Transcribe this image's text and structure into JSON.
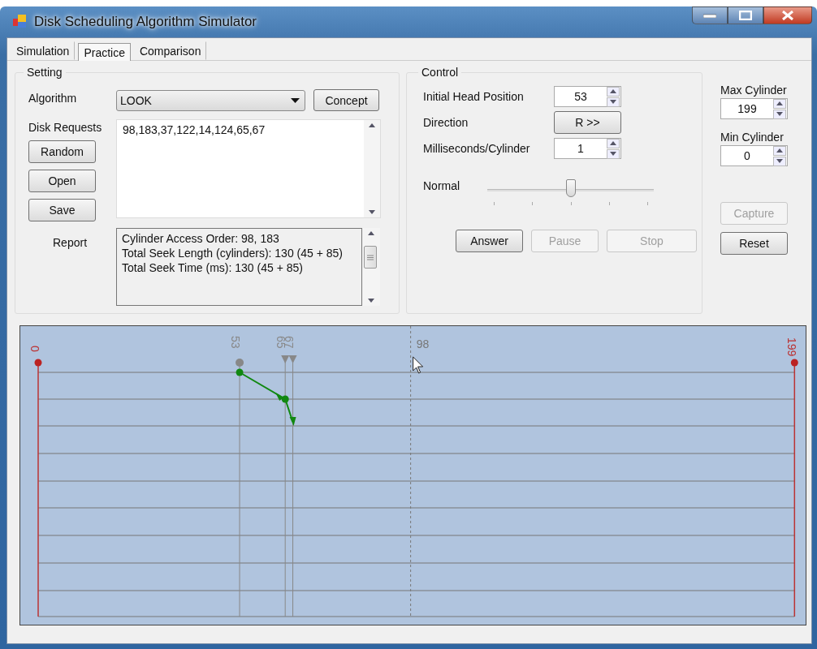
{
  "window": {
    "title": "Disk Scheduling Algorithm Simulator"
  },
  "tabs": [
    {
      "label": "Simulation",
      "selected": false
    },
    {
      "label": "Practice",
      "selected": true
    },
    {
      "label": "Comparison",
      "selected": false
    }
  ],
  "setting": {
    "title": "Setting",
    "algorithm": {
      "label": "Algorithm",
      "value": "LOOK"
    },
    "concept_button": "Concept",
    "disk_requests": {
      "label": "Disk Requests",
      "value": "98,183,37,122,14,124,65,67"
    },
    "buttons": [
      "Random",
      "Open",
      "Save"
    ],
    "report": {
      "label": "Report",
      "lines": [
        "Cylinder Access Order: 98, 183",
        "Total Seek Length (cylinders): 130 (45 + 85)",
        "Total Seek Time (ms): 130 (45 + 85)"
      ]
    }
  },
  "control": {
    "title": "Control",
    "fields": [
      {
        "kind": "spinner",
        "label": "Initial Head Position",
        "value": "53"
      },
      {
        "kind": "button",
        "label": "Direction",
        "value": "R >>"
      },
      {
        "kind": "spinner",
        "label": "Milliseconds/Cylinder",
        "value": "1"
      }
    ],
    "speed": {
      "label": "Normal",
      "level": 0.5
    },
    "buttons": [
      {
        "label": "Answer",
        "disabled": false
      },
      {
        "label": "Pause",
        "disabled": true
      },
      {
        "label": "Stop",
        "disabled": true
      }
    ]
  },
  "limits": [
    {
      "label": "Max Cylinder",
      "value": "199"
    },
    {
      "label": "Min Cylinder",
      "value": "0"
    }
  ],
  "side_buttons": [
    {
      "label": "Capture",
      "disabled": true
    },
    {
      "label": "Reset",
      "disabled": false
    }
  ],
  "track_view": {
    "min_label": "0",
    "max_label": "199",
    "head_label": "53",
    "request_labels": [
      "65",
      "67"
    ],
    "hover_label": "98"
  }
}
